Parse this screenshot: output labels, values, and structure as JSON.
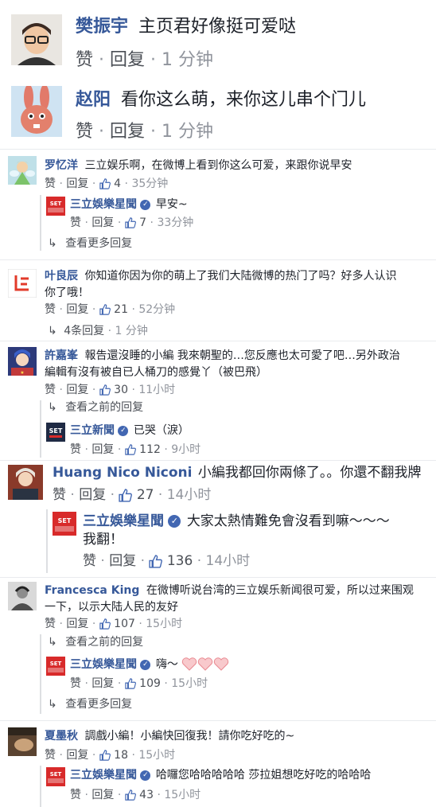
{
  "labels": {
    "like": "赞",
    "reply": "回复",
    "dot": "·",
    "verified": "✓"
  },
  "c1": {
    "name": "樊振宇",
    "text": "主页君好像挺可爱哒",
    "time": "1 分钟"
  },
  "c2": {
    "name": "赵阳",
    "text": "看你这么萌，来你这儿串个门儿",
    "time": "1 分钟"
  },
  "c3": {
    "name": "罗忆洋",
    "text": "三立娱乐啊，在微博上看到你这么可爱，来跟你说早安",
    "likes": "4",
    "time": "35分钟",
    "reply": {
      "name": "三立娛樂星聞",
      "text": "早安~",
      "likes": "7",
      "time": "33分钟"
    },
    "more": "查看更多回复"
  },
  "c4": {
    "name": "叶良辰",
    "text1": "你知道你因为你的萌上了我们大陆微博的热门了吗？好多人认识",
    "text2": "你了哦！",
    "likes": "21",
    "time": "52分钟",
    "replies_count": "4条回复",
    "replies_time": "1 分钟"
  },
  "c5": {
    "name": "許嘉峯",
    "text1": "報告還沒睡的小編 我來朝聖的…您反應也太可愛了吧…另外政治",
    "text2": "編輯有沒有被自已人桶刀的感覺丫（被巴飛）",
    "likes": "30",
    "time": "11小时",
    "prev": "查看之前的回复",
    "reply": {
      "name": "三立新聞",
      "text": "已哭（淚）",
      "likes": "112",
      "time": "9小时",
      "logo": "SET"
    }
  },
  "c6": {
    "name": "Huang Nico Niconi",
    "text": "小編我都回你兩條了。。你還不翻我牌",
    "likes": "27",
    "time": "14小时",
    "reply": {
      "name": "三立娛樂星聞",
      "text1": "大家太熱情難免會沒看到嘛～～～",
      "text2": "我翻！",
      "likes": "136",
      "time": "14小时"
    }
  },
  "c7": {
    "name": "Francesca King",
    "text1": "在微博听说台湾的三立娱乐新闻很可爱，所以过来围观",
    "text2": "一下，以示大陆人民的友好",
    "likes": "107",
    "time": "15小时",
    "prev": "查看之前的回复",
    "reply": {
      "name": "三立娛樂星聞",
      "text": "嗨～",
      "likes": "109",
      "time": "15小时"
    },
    "more": "查看更多回复"
  },
  "c8": {
    "name": "夏墨秋",
    "text": "調戲小編！小編快回復我！請你吃好吃的~",
    "likes": "18",
    "time": "15小时",
    "reply": {
      "name": "三立娛樂星聞",
      "text": "哈囉您哈哈哈哈哈 莎拉姐想吃好吃的哈哈哈",
      "likes": "43",
      "time": "15小时"
    }
  },
  "logo_text": "SET"
}
